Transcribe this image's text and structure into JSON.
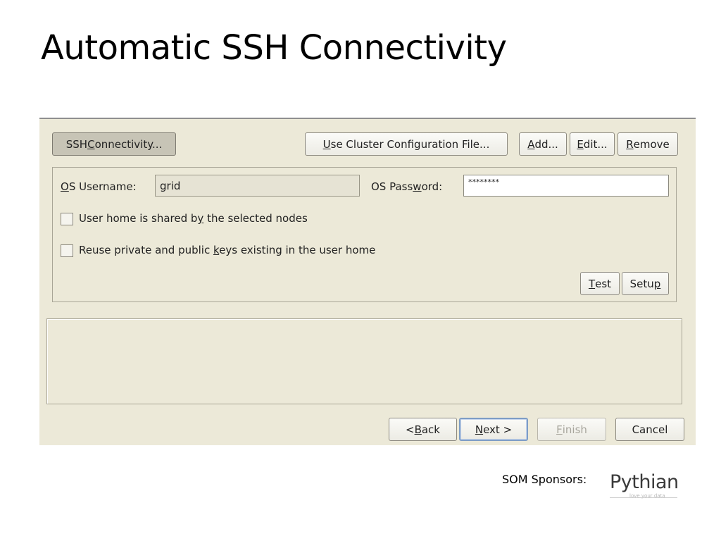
{
  "slide": {
    "title": "Automatic SSH Connectivity",
    "sponsor_label": "SOM Sponsors:",
    "sponsor_logo_text": "Pythian",
    "sponsor_tagline": "love your data"
  },
  "toolbar": {
    "ssh_connectivity": {
      "pre": "SSH ",
      "u": "C",
      "post": "onnectivity..."
    },
    "use_cluster_config": {
      "pre": "",
      "u": "U",
      "post": "se Cluster Configuration File..."
    },
    "add": {
      "pre": "",
      "u": "A",
      "post": "dd..."
    },
    "edit": {
      "pre": "",
      "u": "E",
      "post": "dit..."
    },
    "remove": {
      "pre": "",
      "u": "R",
      "post": "emove"
    }
  },
  "ssh_panel": {
    "os_username_label": {
      "pre": "",
      "u": "O",
      "post": "S Username:"
    },
    "os_username_value": "grid",
    "os_password_label": {
      "pre": "OS Pass",
      "u": "w",
      "post": "ord:"
    },
    "os_password_value": "********",
    "shared_home_label": {
      "pre": "User home is shared b",
      "u": "y",
      "post": " the selected nodes"
    },
    "reuse_keys_label": {
      "pre": "Reuse private and public ",
      "u": "k",
      "post": "eys existing in the user home"
    },
    "test": {
      "pre": "",
      "u": "T",
      "post": "est"
    },
    "setup": {
      "pre": "Setu",
      "u": "p",
      "post": ""
    }
  },
  "navigation": {
    "back": {
      "pre": "< ",
      "u": "B",
      "post": "ack"
    },
    "next": {
      "pre": "",
      "u": "N",
      "post": "ext >"
    },
    "finish": {
      "pre": "",
      "u": "F",
      "post": "inish"
    },
    "cancel": "Cancel"
  },
  "colors": {
    "dialog_background": "#ece9d8",
    "default_button_border": "#7e9dc6"
  }
}
